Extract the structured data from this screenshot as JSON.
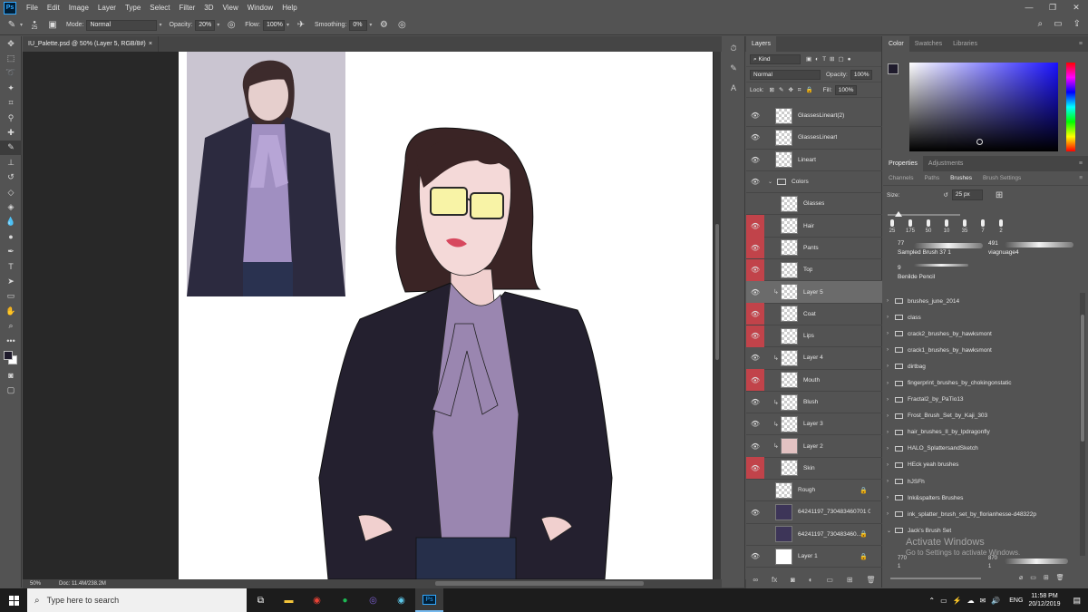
{
  "menu": {
    "logo": "Ps",
    "items": [
      "File",
      "Edit",
      "Image",
      "Layer",
      "Type",
      "Select",
      "Filter",
      "3D",
      "View",
      "Window",
      "Help"
    ]
  },
  "options": {
    "brush_size": "25",
    "mode_label": "Mode:",
    "mode_value": "Normal",
    "opacity_label": "Opacity:",
    "opacity_value": "20%",
    "flow_label": "Flow:",
    "flow_value": "100%",
    "smoothing_label": "Smoothing:",
    "smoothing_value": "0%"
  },
  "document": {
    "tab_title": "IU_Palette.psd @ 50% (Layer 5, RGB/8#)",
    "close": "×",
    "zoom": "50%",
    "doc_size": "Doc: 11.4M/238.2M"
  },
  "layers_panel": {
    "tab": "Layers",
    "filter_label": "Kind",
    "blend_mode": "Normal",
    "opacity_label": "Opacity:",
    "opacity_value": "100%",
    "lock_label": "Lock:",
    "fill_label": "Fill:",
    "fill_value": "100%",
    "layers": [
      {
        "name": "GlassesLineart(2)",
        "eye": "on",
        "thumb": "checker"
      },
      {
        "name": "GlassesLineart",
        "eye": "on",
        "thumb": "checker"
      },
      {
        "name": "Lineart",
        "eye": "on",
        "thumb": "checker"
      },
      {
        "name": "Colors",
        "eye": "on",
        "thumb": "folder"
      },
      {
        "name": "Glasses",
        "eye": "off",
        "thumb": "checker"
      },
      {
        "name": "Hair",
        "eye": "red",
        "thumb": "checker"
      },
      {
        "name": "Pants",
        "eye": "red",
        "thumb": "checker"
      },
      {
        "name": "Top",
        "eye": "red",
        "thumb": "checker"
      },
      {
        "name": "Layer 5",
        "eye": "on",
        "thumb": "checker",
        "clip": true,
        "selected": true
      },
      {
        "name": "Coat",
        "eye": "red",
        "thumb": "checker"
      },
      {
        "name": "Lips",
        "eye": "red",
        "thumb": "checker"
      },
      {
        "name": "Layer 4",
        "eye": "on",
        "thumb": "checker",
        "clip": true
      },
      {
        "name": "Mouth",
        "eye": "red",
        "thumb": "checker"
      },
      {
        "name": "Blush",
        "eye": "on",
        "thumb": "checker",
        "clip": true
      },
      {
        "name": "Layer 3",
        "eye": "on",
        "thumb": "checker",
        "clip": true
      },
      {
        "name": "Layer 2",
        "eye": "on",
        "thumb": "skin",
        "clip": true
      },
      {
        "name": "Skin",
        "eye": "red",
        "thumb": "checker"
      },
      {
        "name": "Rough",
        "eye": "off",
        "thumb": "checker",
        "lock": true
      },
      {
        "name": "64241197_730483460701 0...",
        "eye": "on",
        "thumb": "photo"
      },
      {
        "name": "64241197_730483460...",
        "eye": "off",
        "thumb": "photo",
        "lock": true
      },
      {
        "name": "Layer 1",
        "eye": "on",
        "thumb": "white",
        "lock": true
      }
    ]
  },
  "color_panel": {
    "tabs": [
      "Color",
      "Swatches",
      "Libraries"
    ],
    "fg": "#1f1b2c",
    "bg": "#ffffff"
  },
  "props_panel": {
    "tabs": [
      "Properties",
      "Adjustments"
    ],
    "subtabs": [
      "Channels",
      "Paths",
      "Brushes",
      "Brush Settings"
    ],
    "size_label": "Size:",
    "size_value": "25 px",
    "presets": [
      "25",
      "175",
      "50",
      "10",
      "35",
      "7",
      "2"
    ],
    "samples": [
      {
        "num": "77",
        "name": "Sampled Brush 37 1"
      },
      {
        "num": "491",
        "name": "viagnuage4"
      },
      {
        "num": "9",
        "name": "Benilde Pencil"
      }
    ],
    "folders": [
      "brushes_june_2014",
      "class",
      "crack2_brushes_by_hawksmont",
      "crack1_brushes_by_hawksmont",
      "dirtbag",
      "fingerprint_brushes_by_chokingonstatic",
      "Fractal2_by_PaTio13",
      "Frost_Brush_Set_by_Kaji_303",
      "hair_brushes_II_by_lpdragonfly",
      "HALO_SplattersandSketch",
      "HEck yeah brushes",
      "hJSFh",
      "Ink&spalters Brushes",
      "ink_splatter_brush_set_by_florianhesse-d48322p",
      "Jack's Brush Set"
    ],
    "bottom_nums": [
      "770",
      "1",
      "870",
      "1"
    ]
  },
  "watermark": {
    "title": "Activate Windows",
    "sub": "Go to Settings to activate Windows."
  },
  "taskbar": {
    "search_placeholder": "Type here to search",
    "lang": "ENG",
    "time": "11:58 PM",
    "date": "20/12/2019"
  }
}
